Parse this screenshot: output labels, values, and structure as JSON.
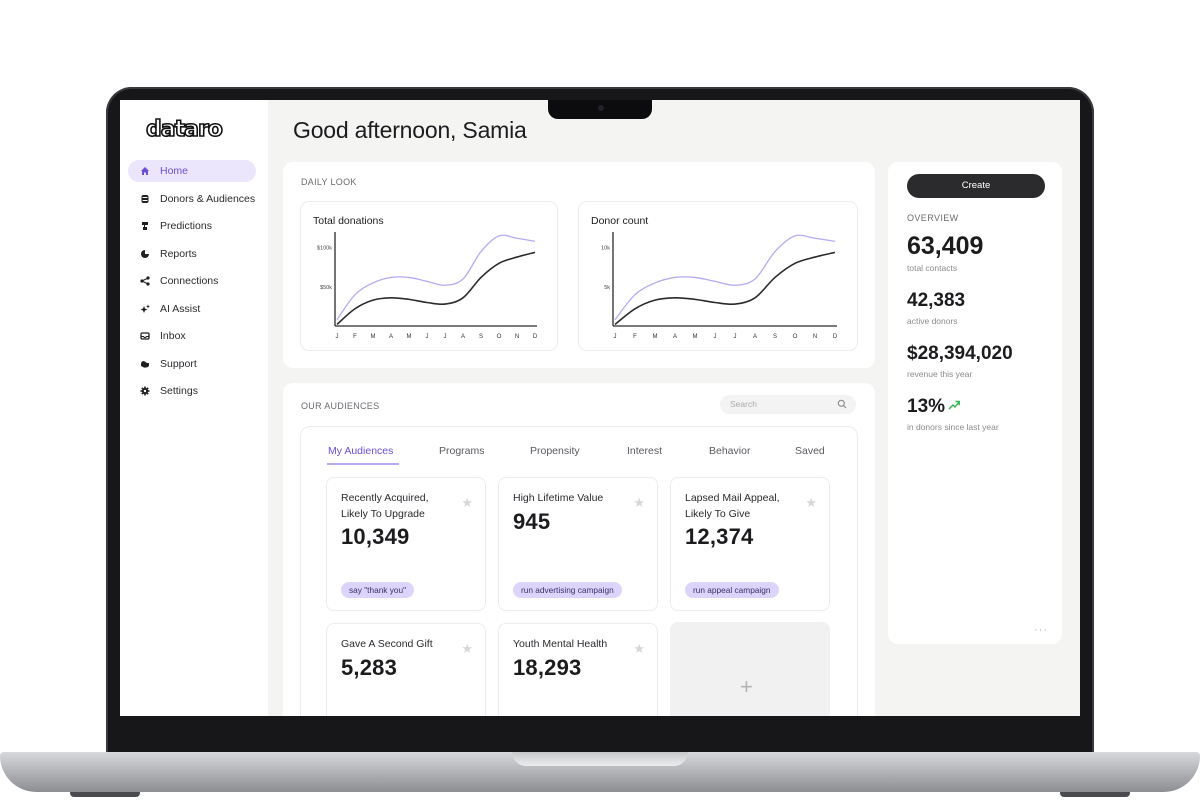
{
  "brand": {
    "logo": "dataro",
    "accent": "#6b4fd8",
    "accent_light": "#b9a9f3"
  },
  "sidebar": {
    "items": [
      {
        "label": "Home",
        "icon": "home-icon",
        "active": true
      },
      {
        "label": "Donors & Audiences",
        "icon": "donors-icon",
        "active": false
      },
      {
        "label": "Predictions",
        "icon": "predictions-icon",
        "active": false
      },
      {
        "label": "Reports",
        "icon": "reports-icon",
        "active": false
      },
      {
        "label": "Connections",
        "icon": "connections-icon",
        "active": false
      },
      {
        "label": "AI Assist",
        "icon": "ai-assist-icon",
        "active": false
      },
      {
        "label": "Inbox",
        "icon": "inbox-icon",
        "active": false
      },
      {
        "label": "Support",
        "icon": "support-icon",
        "active": false
      },
      {
        "label": "Settings",
        "icon": "settings-icon",
        "active": false
      }
    ]
  },
  "header": {
    "greeting": "Good afternoon, Samia"
  },
  "daily_look": {
    "label": "DAILY LOOK",
    "charts": [
      {
        "title": "Total donations",
        "y_ticks": [
          "$100k",
          "$50k"
        ]
      },
      {
        "title": "Donor count",
        "y_ticks": [
          "10k",
          "5k"
        ]
      }
    ]
  },
  "chart_data": [
    {
      "type": "line",
      "title": "Total donations",
      "categories": [
        "J",
        "F",
        "M",
        "A",
        "M",
        "J",
        "J",
        "A",
        "S",
        "O",
        "N",
        "D"
      ],
      "ylim": [
        0,
        120000
      ],
      "series": [
        {
          "values": [
            8000,
            40000,
            55000,
            62000,
            62000,
            57000,
            52000,
            60000,
            95000,
            115000,
            112000,
            108000
          ],
          "color": "#b9a9f3"
        },
        {
          "values": [
            2000,
            22000,
            33000,
            36000,
            34000,
            30000,
            28000,
            36000,
            62000,
            80000,
            88000,
            94000
          ],
          "color": "#2b2b2e"
        }
      ]
    },
    {
      "type": "line",
      "title": "Donor count",
      "categories": [
        "J",
        "F",
        "M",
        "A",
        "M",
        "J",
        "J",
        "A",
        "S",
        "O",
        "N",
        "D"
      ],
      "ylim": [
        0,
        12000
      ],
      "series": [
        {
          "values": [
            800,
            4000,
            5500,
            6200,
            6200,
            5700,
            5200,
            6000,
            9500,
            11500,
            11200,
            10800
          ],
          "color": "#b9a9f3"
        },
        {
          "values": [
            200,
            2200,
            3300,
            3600,
            3400,
            3000,
            2800,
            3600,
            6200,
            8000,
            8800,
            9400
          ],
          "color": "#2b2b2e"
        }
      ]
    }
  ],
  "audiences": {
    "label": "OUR AUDIENCES",
    "search_placeholder": "Search",
    "tabs": [
      "My Audiences",
      "Programs",
      "Propensity",
      "Interest",
      "Behavior",
      "Saved"
    ],
    "active_tab": "My Audiences",
    "cards": [
      {
        "title": "Recently Acquired, Likely To Upgrade",
        "value": "10,349",
        "action": "say \"thank you\""
      },
      {
        "title": "High Lifetime Value",
        "value": "945",
        "action": "run advertising campaign"
      },
      {
        "title": "Lapsed Mail Appeal, Likely To Give",
        "value": "12,374",
        "action": "run appeal campaign"
      },
      {
        "title": "Gave A Second Gift",
        "value": "5,283",
        "action": ""
      },
      {
        "title": "Youth Mental Health",
        "value": "18,293",
        "action": ""
      }
    ],
    "add_label": "+"
  },
  "overview": {
    "create_label": "Create",
    "label": "OVERVIEW",
    "stats": [
      {
        "value": "63,409",
        "sub": "total contacts"
      },
      {
        "value": "42,383",
        "sub": "active donors"
      },
      {
        "value": "$28,394,020",
        "sub": "revenue this year"
      },
      {
        "value": "13%",
        "sub": "in donors since last year",
        "trend": "up",
        "trend_color": "#2fb24c"
      }
    ],
    "more_label": "···"
  }
}
